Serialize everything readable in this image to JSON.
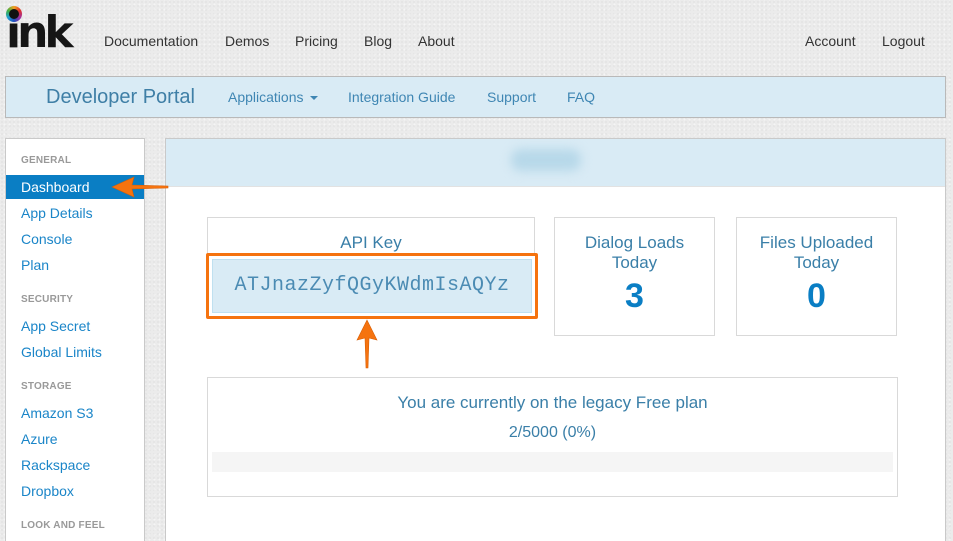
{
  "logo": {
    "text": "ink"
  },
  "topnav": {
    "left": [
      {
        "label": "Documentation"
      },
      {
        "label": "Demos"
      },
      {
        "label": "Pricing"
      },
      {
        "label": "Blog"
      },
      {
        "label": "About"
      }
    ],
    "right": [
      {
        "label": "Account"
      },
      {
        "label": "Logout"
      }
    ]
  },
  "subnav": {
    "brand": "Developer Portal",
    "links": [
      {
        "label": "Applications",
        "has_dropdown": true
      },
      {
        "label": "Integration Guide"
      },
      {
        "label": "Support"
      },
      {
        "label": "FAQ"
      }
    ]
  },
  "sidebar": {
    "sections": [
      {
        "title": "GENERAL",
        "items": [
          "Dashboard",
          "App Details",
          "Console",
          "Plan"
        ]
      },
      {
        "title": "SECURITY",
        "items": [
          "App Secret",
          "Global Limits"
        ]
      },
      {
        "title": "STORAGE",
        "items": [
          "Amazon S3",
          "Azure",
          "Rackspace",
          "Dropbox"
        ]
      },
      {
        "title": "LOOK AND FEEL",
        "items": []
      }
    ],
    "active_item": "Dashboard"
  },
  "main": {
    "header_title_redacted": true,
    "api_key": {
      "label": "API Key",
      "value": "ATJnazZyfQGyKWdmIsAQYz"
    },
    "dialog_loads": {
      "label_line1": "Dialog Loads",
      "label_line2": "Today",
      "value": "3"
    },
    "files_uploaded": {
      "label_line1": "Files Uploaded",
      "label_line2": "Today",
      "value": "0"
    },
    "plan": {
      "text": "You are currently on the legacy Free plan",
      "usage": "2/5000 (0%)",
      "progress_percent": 0
    }
  },
  "colors": {
    "accent": "#0a7ec4",
    "link": "#1a85c8",
    "subnav_bg": "#d9ebf5",
    "annotation": "#f5730f"
  }
}
